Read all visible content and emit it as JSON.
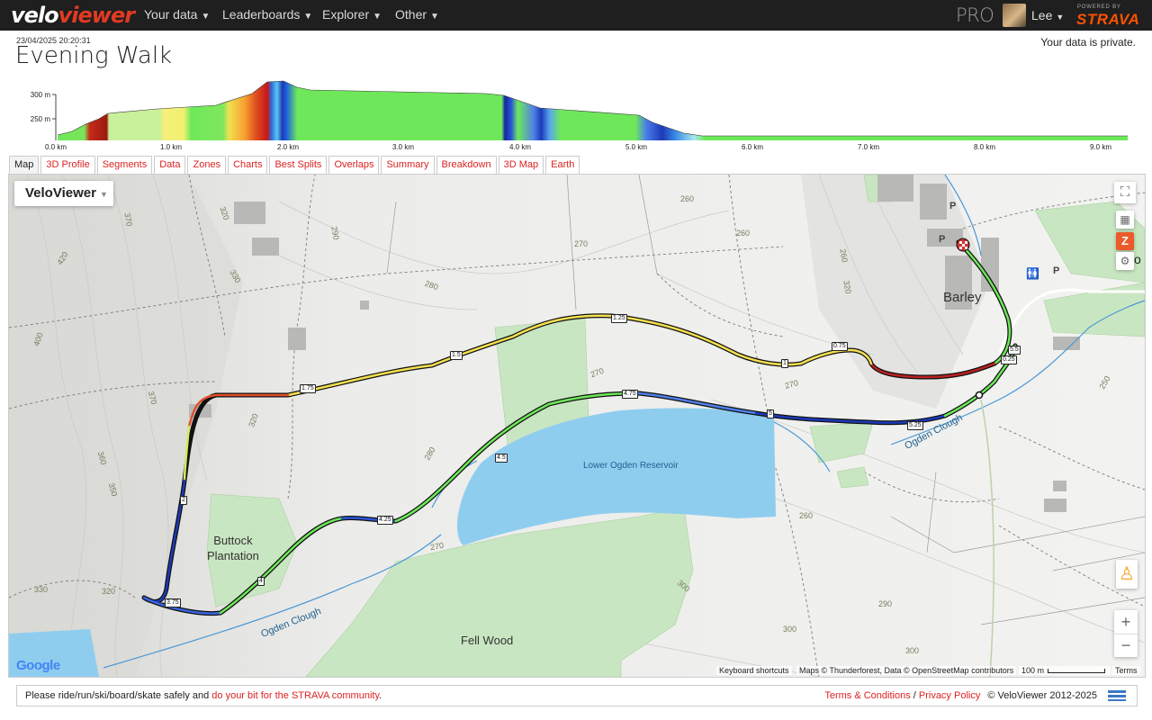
{
  "nav": {
    "logo_part1": "velo",
    "logo_part2": "viewer",
    "items": [
      {
        "label": "Your data"
      },
      {
        "label": "Leaderboards"
      },
      {
        "label": "Explorer"
      },
      {
        "label": "Other"
      }
    ],
    "pro_label": "PRO",
    "user_label": "Lee",
    "powered_by": "POWERED BY",
    "strava": "STRAVA"
  },
  "activity": {
    "datetime": "23/04/2025 20:20:31",
    "title": "Evening Walk",
    "privacy": "Your data is private."
  },
  "elevation": {
    "y_ticks": [
      "300 m",
      "250 m"
    ],
    "x_ticks": [
      "0.0 km",
      "1.0 km",
      "2.0 km",
      "3.0 km",
      "4.0 km",
      "5.0 km",
      "6.0 km",
      "7.0 km",
      "8.0 km",
      "9.0 km"
    ]
  },
  "tabs": [
    {
      "label": "Map",
      "active": true
    },
    {
      "label": "3D Profile"
    },
    {
      "label": "Segments"
    },
    {
      "label": "Data"
    },
    {
      "label": "Zones"
    },
    {
      "label": "Charts"
    },
    {
      "label": "Best Splits"
    },
    {
      "label": "Overlaps"
    },
    {
      "label": "Summary"
    },
    {
      "label": "Breakdown"
    },
    {
      "label": "3D Map"
    },
    {
      "label": "Earth"
    }
  ],
  "map": {
    "layer_select": "VeloViewer",
    "places": {
      "barley": "Barley",
      "buttock": "Buttock\nPlantation",
      "fell_wood": "Fell Wood",
      "reservoir": "Lower Ogden Reservoir",
      "ogden_clough_1": "Ogden Clough",
      "ogden_clough_2": "Ogden Clough",
      "no_label": "N o"
    },
    "km_markers": [
      "0.25",
      "0.75",
      "1",
      "1.25",
      "1.5",
      "1.75",
      "2",
      "3.75",
      "4",
      "4.25",
      "4.5",
      "4.75",
      "5",
      "5.25",
      "5.5"
    ],
    "contours": [
      "370",
      "320",
      "290",
      "270",
      "260",
      "260",
      "280",
      "270",
      "270",
      "360",
      "350",
      "320",
      "330",
      "420",
      "400",
      "330",
      "280",
      "260",
      "250",
      "300",
      "290",
      "300",
      "370",
      "300",
      "320",
      "320",
      "260",
      "270"
    ],
    "attribution": "Maps © Thunderforest, Data © OpenStreetMap contributors",
    "shortcuts": "Keyboard shortcuts",
    "scale": "100 m",
    "terms": "Terms",
    "google": "Google",
    "zoom_in": "+",
    "zoom_out": "−"
  },
  "footer": {
    "text1": "Please ride/run/ski/board/skate safely and ",
    "link1": "do your bit for the STRAVA community",
    "text1_end": ".",
    "terms": "Terms & Conditions",
    "sep": " / ",
    "privacy": "Privacy Policy",
    "copyright": "© VeloViewer 2012-2025"
  },
  "colors": {
    "brand_red": "#e23a22",
    "strava_orange": "#fc5200",
    "link_red": "#d22222",
    "water": "#8fcdef",
    "forest": "#c9e6c2"
  }
}
